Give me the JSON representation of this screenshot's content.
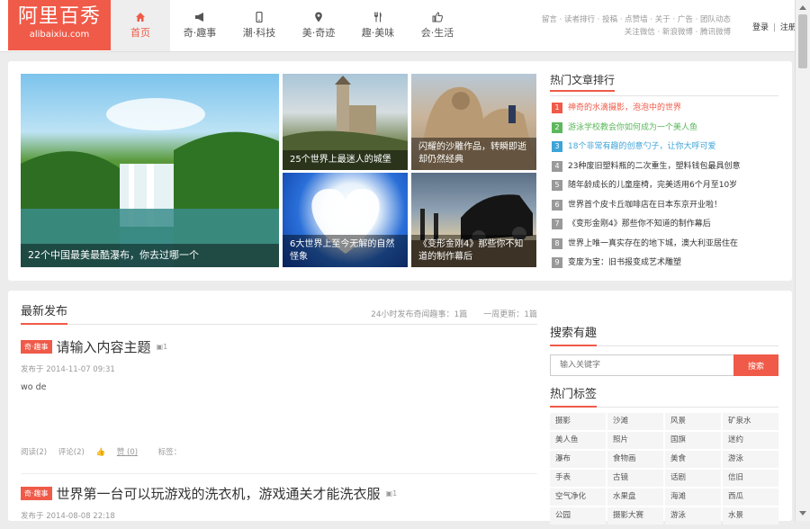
{
  "header": {
    "logo_title": "阿里百秀",
    "logo_url": "alibaixiu.com",
    "nav": [
      {
        "label": "首页",
        "icon": "home-icon",
        "active": true
      },
      {
        "label": "奇·趣事",
        "icon": "megaphone-icon"
      },
      {
        "label": "潮·科技",
        "icon": "phone-icon"
      },
      {
        "label": "美·奇迹",
        "icon": "location-pin-icon"
      },
      {
        "label": "趣·美味",
        "icon": "fork-knife-icon"
      },
      {
        "label": "会·生活",
        "icon": "thumbs-up-icon"
      }
    ],
    "links_line1": "留言 · 读者排行 · 投稿 · 点赞墙 · 关于 · 广告 · 团队动态",
    "links_line2": "关注微信 · 新浪微博 · 腾讯微博",
    "login": "登录",
    "separator": "|",
    "register": "注册"
  },
  "slider": {
    "big_caption": "22个中国最美最酷瀑布，你去过哪一个",
    "castle_caption": "25个世界上最迷人的城堡",
    "sand_caption": "闪耀的沙雕作品，转瞬即逝却仍然经典",
    "cloud_caption": "6大世界上至今无解的自然怪象",
    "car_caption": "《变形金刚4》那些你不知道的制作幕后"
  },
  "hot": {
    "title": "热门文章排行",
    "items": [
      {
        "num": "1",
        "text": "神奇的水滴摄影，泡泡中的世界",
        "color": "#f05a48"
      },
      {
        "num": "2",
        "text": "游泳学校教会你如何成为一个美人鱼",
        "color": "#5cb85c"
      },
      {
        "num": "3",
        "text": "18个非常有趣的创意勺子，让你大呼可爱",
        "color": "#3fa4d8"
      },
      {
        "num": "4",
        "text": "23种废旧塑料瓶的二次重生，塑料钱包最具创意",
        "color": ""
      },
      {
        "num": "5",
        "text": "随年龄成长的儿童座椅，完美适用6个月至10岁",
        "color": ""
      },
      {
        "num": "6",
        "text": "世界首个皮卡丘咖啡店在日本东京开业啦！",
        "color": ""
      },
      {
        "num": "7",
        "text": "《变形金刚4》那些你不知道的制作幕后",
        "color": ""
      },
      {
        "num": "8",
        "text": "世界上唯一真实存在的地下城，澳大利亚居住在",
        "color": ""
      },
      {
        "num": "9",
        "text": "变废为宝：旧书报变成艺术雕塑",
        "color": ""
      }
    ]
  },
  "latest": {
    "title": "最新发布",
    "stats": "24小时发布奇闻趣事：1篇　　一周更新：1篇",
    "posts": [
      {
        "tag": "奇·趣事",
        "title": "请输入内容主题",
        "img_count": "1",
        "date": "发布于 2014-11-07 09:31",
        "body": "wo de",
        "read": "阅读(2)",
        "comments": "评论(2)",
        "likes": "赞 (0)",
        "tags": "标签："
      },
      {
        "tag": "奇·趣事",
        "title": "世界第一台可以玩游戏的洗衣机，游戏通关才能洗衣服",
        "img_count": "1",
        "date": "发布于 2014-08-08 22:18"
      }
    ]
  },
  "search": {
    "title": "搜索有趣",
    "placeholder": "输入关键字",
    "button": "搜索"
  },
  "tags_section": {
    "title": "热门标签",
    "tags": [
      "摄影",
      "沙滩",
      "风景",
      "矿泉水",
      "美人鱼",
      "照片",
      "国旗",
      "迷约",
      "瀑布",
      "食物画",
      "美食",
      "游泳",
      "手表",
      "古镜",
      "话剧",
      "信旧",
      "空气净化",
      "水果盘",
      "海滩",
      "西瓜",
      "公园",
      "摄影大赛",
      "游泳",
      "水景"
    ]
  },
  "colors": {
    "accent": "#f05a48",
    "hot2": "#5cb85c",
    "hot3": "#3fa4d8"
  }
}
